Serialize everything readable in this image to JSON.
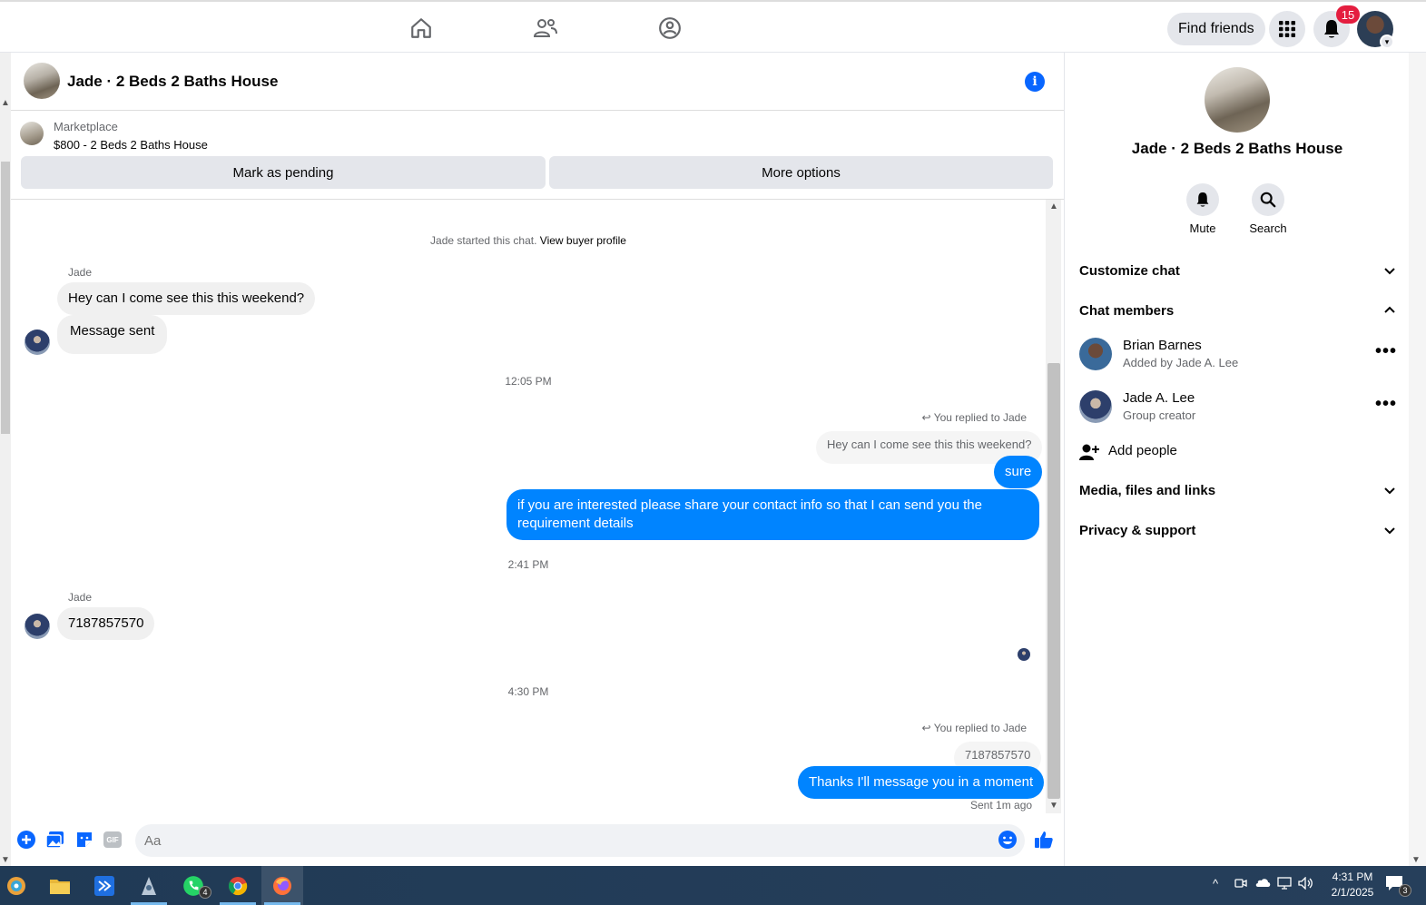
{
  "topnav": {
    "find_friends": "Find friends",
    "notification_count": "15",
    "icons": [
      "home-icon",
      "friends-icon",
      "groups-icon",
      "menu-grid-icon",
      "bell-icon"
    ]
  },
  "chat": {
    "title": "Jade · 2 Beds 2 Baths House",
    "marketplace_label": "Marketplace",
    "listing": "$800 - 2 Beds 2 Baths House",
    "mark_pending": "Mark as pending",
    "more_options": "More options"
  },
  "messages": {
    "started_text": "Jade started this chat.",
    "view_buyer_profile": "View buyer profile",
    "sender1": "Jade",
    "msg1": "Hey can I come see this this weekend?",
    "msg2": "Message sent",
    "time1": "12:05 PM",
    "reply_note1": "You replied to Jade",
    "quote1": "Hey can I come see this this weekend?",
    "out1": "sure",
    "out2": "if you are interested please share your contact info so that I can send you the requirement details",
    "time2": "2:41 PM",
    "sender2": "Jade",
    "msg3": "7187857570",
    "time3": "4:30 PM",
    "reply_note2": "You replied to Jade",
    "quote2": "7187857570",
    "out3": "Thanks I'll message you in a moment",
    "sent_status": "Sent 1m ago"
  },
  "composer": {
    "placeholder": "Aa",
    "gif_label": "GIF"
  },
  "right_panel": {
    "title": "Jade · 2 Beds 2 Baths House",
    "mute": "Mute",
    "search": "Search",
    "customize_chat": "Customize chat",
    "chat_members": "Chat members",
    "members": [
      {
        "name": "Brian Barnes",
        "sub": "Added by Jade A. Lee"
      },
      {
        "name": "Jade A. Lee",
        "sub": "Group creator"
      }
    ],
    "add_people": "Add people",
    "media": "Media, files and links",
    "privacy": "Privacy & support",
    "more_dots": "•••"
  },
  "taskbar": {
    "whatsapp_badge": "4",
    "notif_badge": "3",
    "time": "4:31 PM",
    "date": "2/1/2025"
  },
  "colors": {
    "accent": "#0866ff",
    "outgoing_bubble": "#0084ff",
    "incoming_bubble": "#f0f0f0",
    "badge": "#e41e3f"
  }
}
